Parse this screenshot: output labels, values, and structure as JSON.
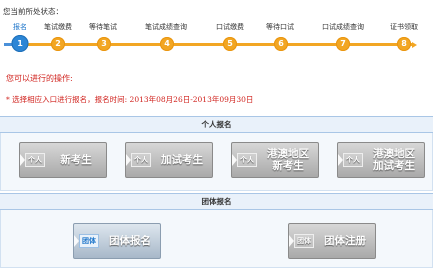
{
  "status": {
    "title": "您当前所处状态："
  },
  "steps": [
    {
      "label": "报名",
      "number": "1"
    },
    {
      "label": "笔试缴费",
      "number": "2"
    },
    {
      "label": "等待笔试",
      "number": "3"
    },
    {
      "label": "笔试成绩查询",
      "number": "4"
    },
    {
      "label": "口试缴费",
      "number": "5"
    },
    {
      "label": "等待口试",
      "number": "6"
    },
    {
      "label": "口试成绩查询",
      "number": "7"
    },
    {
      "label": "证书领取",
      "number": "8"
    }
  ],
  "operations": {
    "title": "您可以进行的操作:",
    "note": "* 选择相应入口进行报名，报名时间: 2013年08月26日-2013年09月30日"
  },
  "personal_section": {
    "title": "个人报名",
    "buttons": [
      {
        "tag": "个人",
        "label": "新考生"
      },
      {
        "tag": "个人",
        "label": "加试考生"
      },
      {
        "tag": "个人",
        "label": "港澳地区新考生"
      },
      {
        "tag": "个人",
        "label": "港澳地区加试考生"
      }
    ]
  },
  "group_section": {
    "title": "团体报名",
    "buttons": [
      {
        "tag": "团体",
        "label": "团体报名"
      },
      {
        "tag": "团体",
        "label": "团体注册"
      }
    ]
  },
  "colors": {
    "active_step": "#2d86d6",
    "pending_step": "#f2a623",
    "alert_text": "#d0211c",
    "section_bg": "#e9f1fa"
  }
}
